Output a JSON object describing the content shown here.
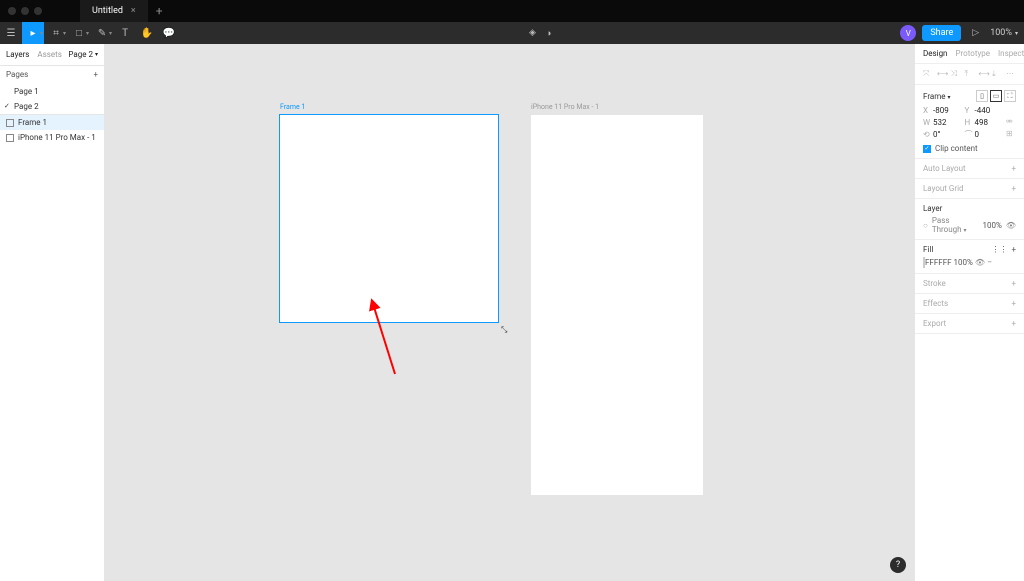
{
  "titlebar": {
    "doc": "Untitled",
    "close": "×",
    "add": "+"
  },
  "toolbar": {
    "avatar": "V",
    "share": "Share",
    "zoom": "100%"
  },
  "left": {
    "tab_layers": "Layers",
    "tab_assets": "Assets",
    "page_indicator": "Page 2",
    "pages_label": "Pages",
    "pages_plus": "+",
    "pages": [
      "Page 1",
      "Page 2"
    ],
    "layers": [
      "Frame 1",
      "iPhone 11 Pro Max - 1"
    ]
  },
  "canvas": {
    "frame1_label": "Frame 1",
    "frame2_label": "iPhone 11 Pro Max - 1"
  },
  "right": {
    "tab_design": "Design",
    "tab_prototype": "Prototype",
    "tab_inspect": "Inspect",
    "frame_header": "Frame",
    "x": "-809",
    "y": "-440",
    "w": "532",
    "h": "498",
    "rot": "0°",
    "radius": "0",
    "clip": "Clip content",
    "auto_layout": "Auto Layout",
    "layout_grid": "Layout Grid",
    "layer": "Layer",
    "pass_through": "Pass Through",
    "pt_opacity": "100%",
    "fill": "Fill",
    "fill_hex": "FFFFFF",
    "fill_opacity": "100%",
    "stroke": "Stroke",
    "effects": "Effects",
    "export": "Export"
  },
  "help": "?"
}
